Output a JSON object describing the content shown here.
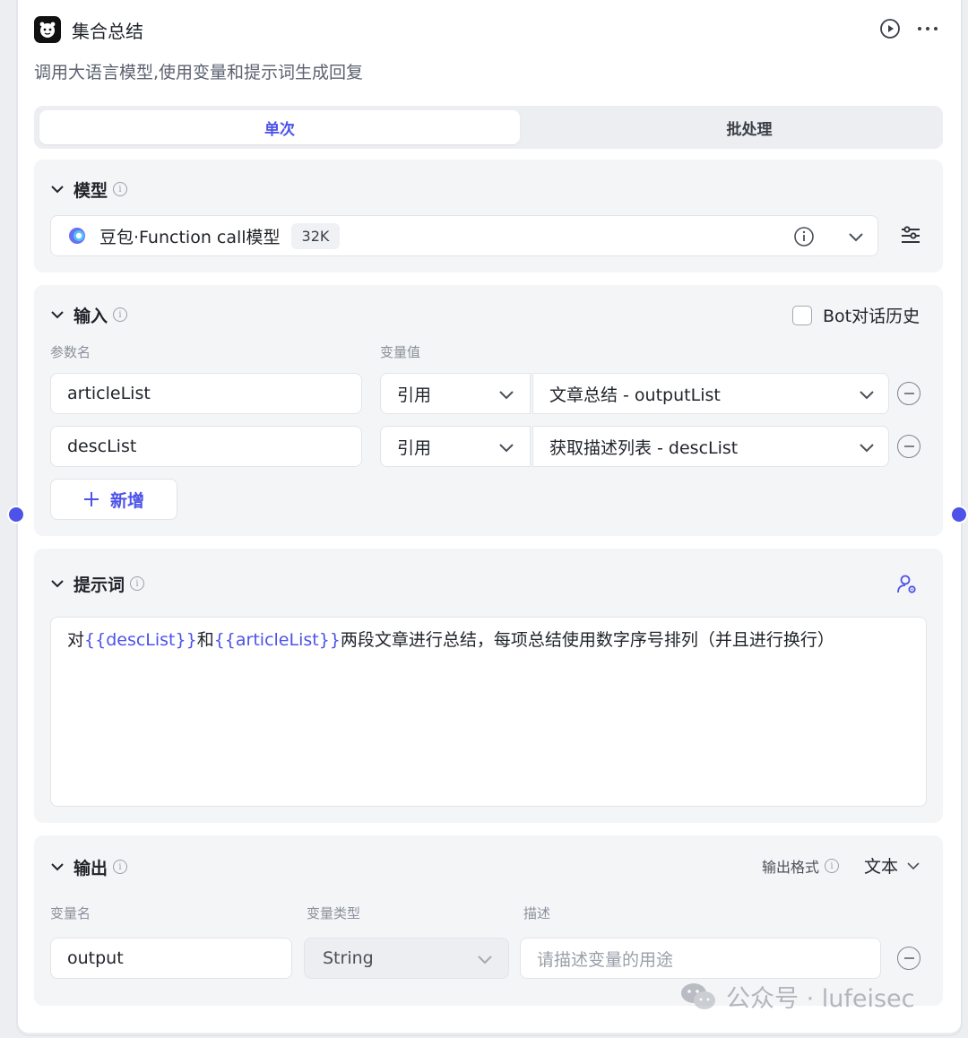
{
  "header": {
    "title": "集合总结",
    "description": "调用大语言模型,使用变量和提示词生成回复"
  },
  "tabs": [
    {
      "label": "单次",
      "active": true
    },
    {
      "label": "批处理",
      "active": false
    }
  ],
  "model": {
    "section_label": "模型",
    "name": "豆包·Function call模型",
    "badge": "32K"
  },
  "input": {
    "section_label": "输入",
    "bot_history_label": "Bot对话历史",
    "col_param": "参数名",
    "col_value": "变量值",
    "rows": [
      {
        "name": "articleList",
        "type": "引用",
        "value": "文章总结 - outputList"
      },
      {
        "name": "descList",
        "type": "引用",
        "value": "获取描述列表 - descList"
      }
    ],
    "add_label": "新增"
  },
  "prompt": {
    "section_label": "提示词",
    "text_parts": [
      "对",
      "{{descList}}",
      "和",
      "{{articleList}}",
      "两段文章进行总结，每项总结使用数字序号排列（并且进行换行）"
    ]
  },
  "output": {
    "section_label": "输出",
    "format_label": "输出格式",
    "format_value": "文本",
    "col_name": "变量名",
    "col_type": "变量类型",
    "col_desc": "描述",
    "row": {
      "name": "output",
      "type": "String",
      "desc_placeholder": "请描述变量的用途"
    }
  },
  "watermark": "公众号 · lufeisec",
  "colors": {
    "accent": "#4d53e8",
    "section_bg": "#f4f5f7"
  }
}
